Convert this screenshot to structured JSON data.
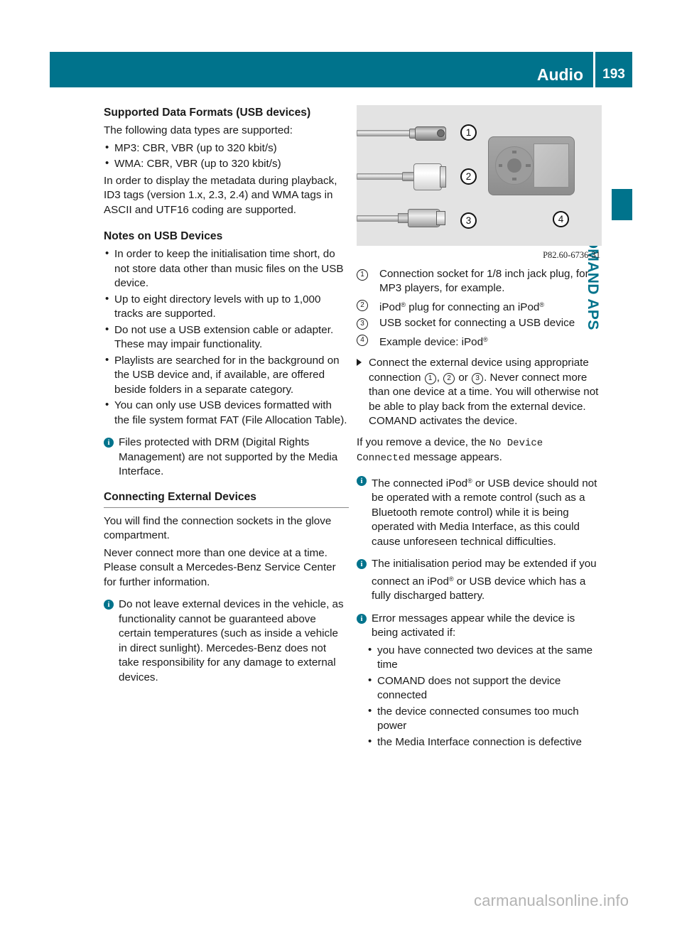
{
  "header": {
    "title": "Audio",
    "page_number": "193"
  },
  "side_tab": {
    "label": "COMAND APS",
    "color": "#00738c"
  },
  "left_column": {
    "heading_1": "Supported Data Formats (USB devices)",
    "intro": "The following data types are supported:",
    "format_bullets": [
      "MP3: CBR, VBR (up to 320 kbit/s)",
      "WMA: CBR, VBR (up to 320 kbit/s)"
    ],
    "metadata_para": "In order to display the metadata during playback, ID3 tags (version 1.x, 2.3, 2.4) and WMA tags in ASCII and UTF16 coding are supported.",
    "heading_2": "Notes on USB Devices",
    "usb_bullets": [
      "In order to keep the initialisation time short, do not store data other than music files on the USB device.",
      "Up to eight directory levels with up to 1,000 tracks are supported.",
      "Do not use a USB extension cable or adapter. These may impair functionality.",
      "Playlists are searched for in the background on the USB device and, if available, are offered beside folders in a separate category.",
      "You can only use USB devices formatted with the file system format FAT (File Allocation Table)."
    ],
    "drm_note": "Files protected with DRM (Digital Rights Management) are not supported by the Media Interface.",
    "heading_3": "Connecting External Devices",
    "sockets_para": "You will find the connection sockets in the glove compartment.",
    "never_connect_para": "Never connect more than one device at a time. Please consult a Mercedes-Benz Service Center for further information.",
    "leave_devices_note": "Do not leave external devices in the vehicle, as functionality cannot be guaranteed above certain temperatures (such as inside a vehicle in direct sunlight). Mercedes-Benz does not take responsibility for any damage to external devices."
  },
  "figure": {
    "code": "P82.60-6736-31",
    "callouts": [
      "1",
      "2",
      "3",
      "4"
    ],
    "items": [
      {
        "label": "jack-plug-cable",
        "callout": "1"
      },
      {
        "label": "ipod-dock-cable",
        "callout": "2"
      },
      {
        "label": "usb-cable",
        "callout": "3"
      },
      {
        "label": "example-ipod-device",
        "callout": "4"
      }
    ]
  },
  "right_column": {
    "legend": [
      {
        "num": "1",
        "text_before": "Connection socket for 1/8 inch jack plug, for MP3 players, for example.",
        "text_after": ""
      },
      {
        "num": "2",
        "text_before": "iPod",
        "text_after": " plug for connecting an iPod"
      },
      {
        "num": "3",
        "text_before": "USB socket for connecting a USB device",
        "text_after": ""
      },
      {
        "num": "4",
        "text_before": "Example device: iPod",
        "text_after": ""
      }
    ],
    "legend_1": "Connection socket for 1/8 inch jack plug, for MP3 players, for example.",
    "legend_2_a": "iPod",
    "legend_2_b": " plug for connecting an iPod",
    "legend_3": "USB socket for connecting a USB device",
    "legend_4": "Example device: iPod",
    "step_part_1": "Connect the external device using appropriate connection ",
    "step_part_2": ", ",
    "step_part_3": " or ",
    "step_part_4": ". Never connect more than one device at a time. You will otherwise not be able to play back from the external device. COMAND activates the device.",
    "step_nums": [
      "1",
      "2",
      "3"
    ],
    "remove_para_a": "If you remove a device, the ",
    "remove_para_mono": "No Device Connected",
    "remove_para_b": " message appears.",
    "note_remote_a": "The connected iPod",
    "note_remote_b": " or USB device should not be operated with a remote control (such as a Bluetooth remote control) while it is being operated with Media Interface, as this could cause unforeseen technical difficulties.",
    "note_init_a": "The initialisation period may be extended if you connect an iPod",
    "note_init_b": " or USB device which has a fully discharged battery.",
    "note_error": "Error messages appear while the device is being activated if:",
    "error_bullets": [
      "you have connected two devices at the same time",
      "COMAND does not support the device connected",
      "the device connected consumes too much power",
      "the Media Interface connection is defective"
    ]
  },
  "watermark": "carmanualsonline.info",
  "registered_mark": "®"
}
